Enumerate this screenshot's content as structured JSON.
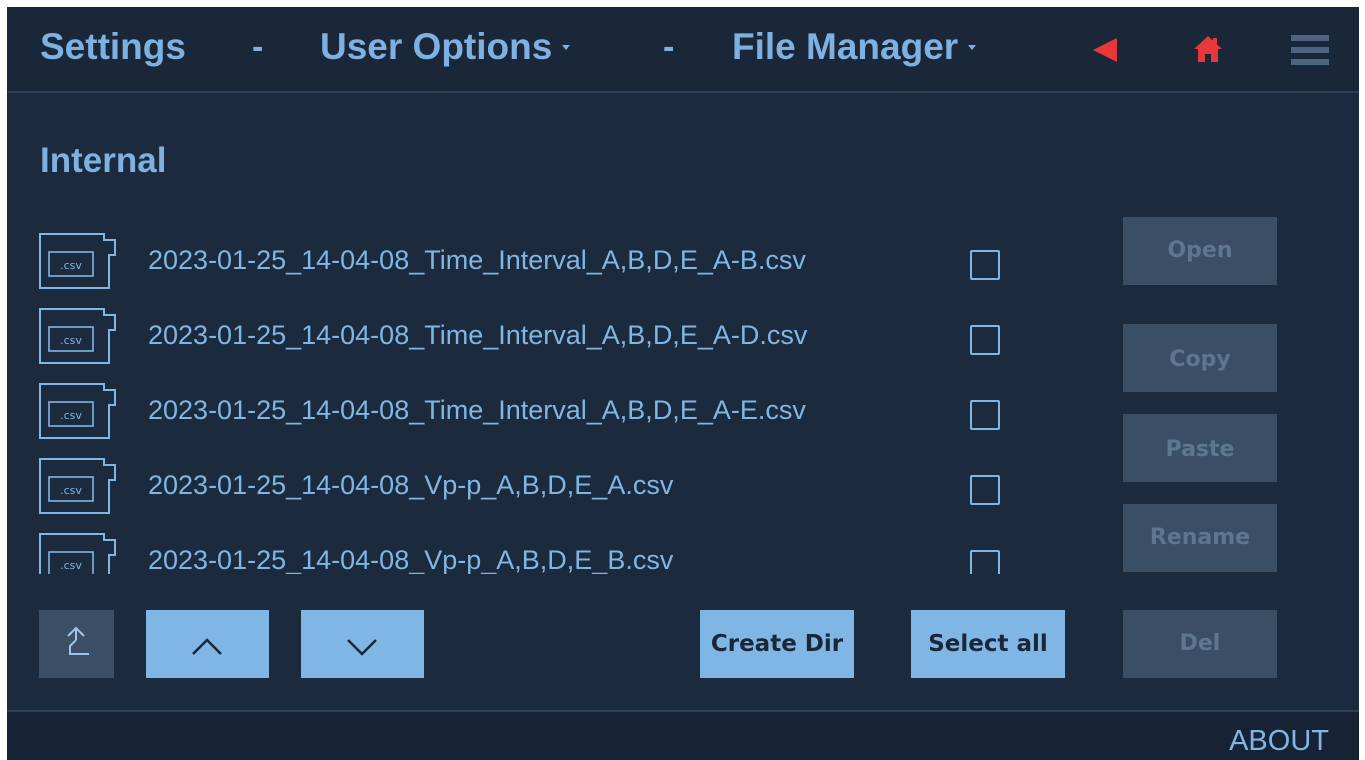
{
  "header": {
    "crumbs": {
      "settings": "Settings",
      "user_options": "User Options",
      "file_manager": "File Manager"
    },
    "separator": "-",
    "accent_color": "#e8373a",
    "text_color": "#7eb1e0"
  },
  "section": {
    "title": "Internal"
  },
  "files": [
    {
      "icon_label": ".csv",
      "name": "2023-01-25_14-04-08_Time_Interval_A,B,D,E_A-B.csv",
      "checked": false
    },
    {
      "icon_label": ".csv",
      "name": "2023-01-25_14-04-08_Time_Interval_A,B,D,E_A-D.csv",
      "checked": false
    },
    {
      "icon_label": ".csv",
      "name": "2023-01-25_14-04-08_Time_Interval_A,B,D,E_A-E.csv",
      "checked": false
    },
    {
      "icon_label": ".csv",
      "name": "2023-01-25_14-04-08_Vp-p_A,B,D,E_A.csv",
      "checked": false
    },
    {
      "icon_label": ".csv",
      "name": "2023-01-25_14-04-08_Vp-p_A,B,D,E_B.csv",
      "checked": false
    }
  ],
  "actions": {
    "open": "Open",
    "copy": "Copy",
    "paste": "Paste",
    "rename": "Rename",
    "del": "Del"
  },
  "bottom": {
    "create_dir": "Create Dir",
    "select_all": "Select all"
  },
  "footer": {
    "about": "ABOUT"
  }
}
